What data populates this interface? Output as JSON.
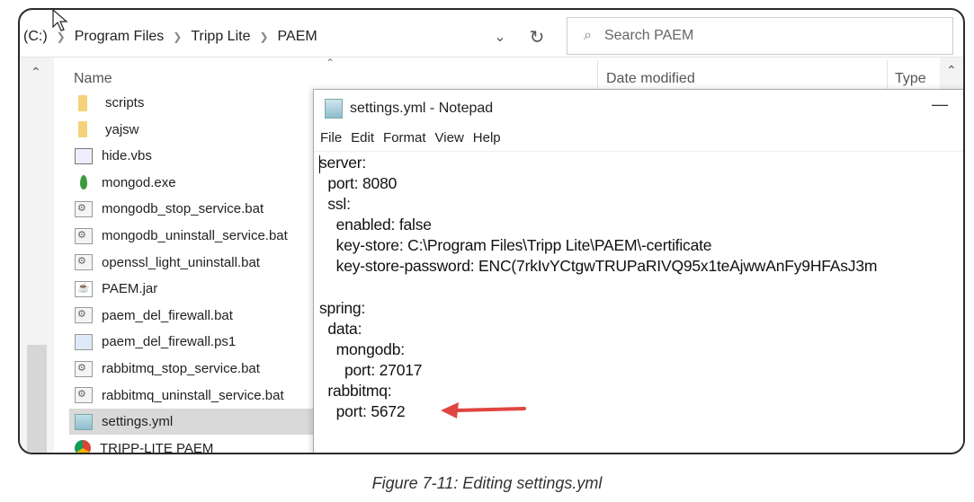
{
  "explorer": {
    "breadcrumb": [
      "(C:)",
      "Program Files",
      "Tripp Lite",
      "PAEM"
    ],
    "search_placeholder": "Search PAEM",
    "columns": {
      "name": "Name",
      "date_modified": "Date modified",
      "type": "Type"
    },
    "files": [
      {
        "name": "scripts",
        "icon": "folder"
      },
      {
        "name": "yajsw",
        "icon": "folder"
      },
      {
        "name": "hide.vbs",
        "icon": "script"
      },
      {
        "name": "mongod.exe",
        "icon": "leaf"
      },
      {
        "name": "mongodb_stop_service.bat",
        "icon": "bat"
      },
      {
        "name": "mongodb_uninstall_service.bat",
        "icon": "bat"
      },
      {
        "name": "openssl_light_uninstall.bat",
        "icon": "bat"
      },
      {
        "name": "PAEM.jar",
        "icon": "jar"
      },
      {
        "name": "paem_del_firewall.bat",
        "icon": "bat"
      },
      {
        "name": "paem_del_firewall.ps1",
        "icon": "ps"
      },
      {
        "name": "rabbitmq_stop_service.bat",
        "icon": "bat"
      },
      {
        "name": "rabbitmq_uninstall_service.bat",
        "icon": "bat"
      },
      {
        "name": "settings.yml",
        "icon": "yml",
        "selected": true
      },
      {
        "name": "TRIPP-LITE PAEM",
        "icon": "chrome"
      }
    ]
  },
  "notepad": {
    "title": "settings.yml - Notepad",
    "menu": [
      "File",
      "Edit",
      "Format",
      "View",
      "Help"
    ],
    "lines": [
      "server:",
      "  port: 8080",
      "  ssl:",
      "    enabled: false",
      "    key-store: C:\\Program Files\\Tripp Lite\\PAEM\\-certificate",
      "    key-store-password: ENC(7rkIvYCtgwTRUPaRIVQ95x1teAjwwAnFy9HFAsJ3m",
      "",
      "spring:",
      "  data:",
      "    mongodb:",
      "      port: 27017",
      "  rabbitmq:",
      "    port: 5672"
    ]
  },
  "annotation_color": "#e0453f",
  "caption": "Figure 7-11: Editing settings.yml"
}
